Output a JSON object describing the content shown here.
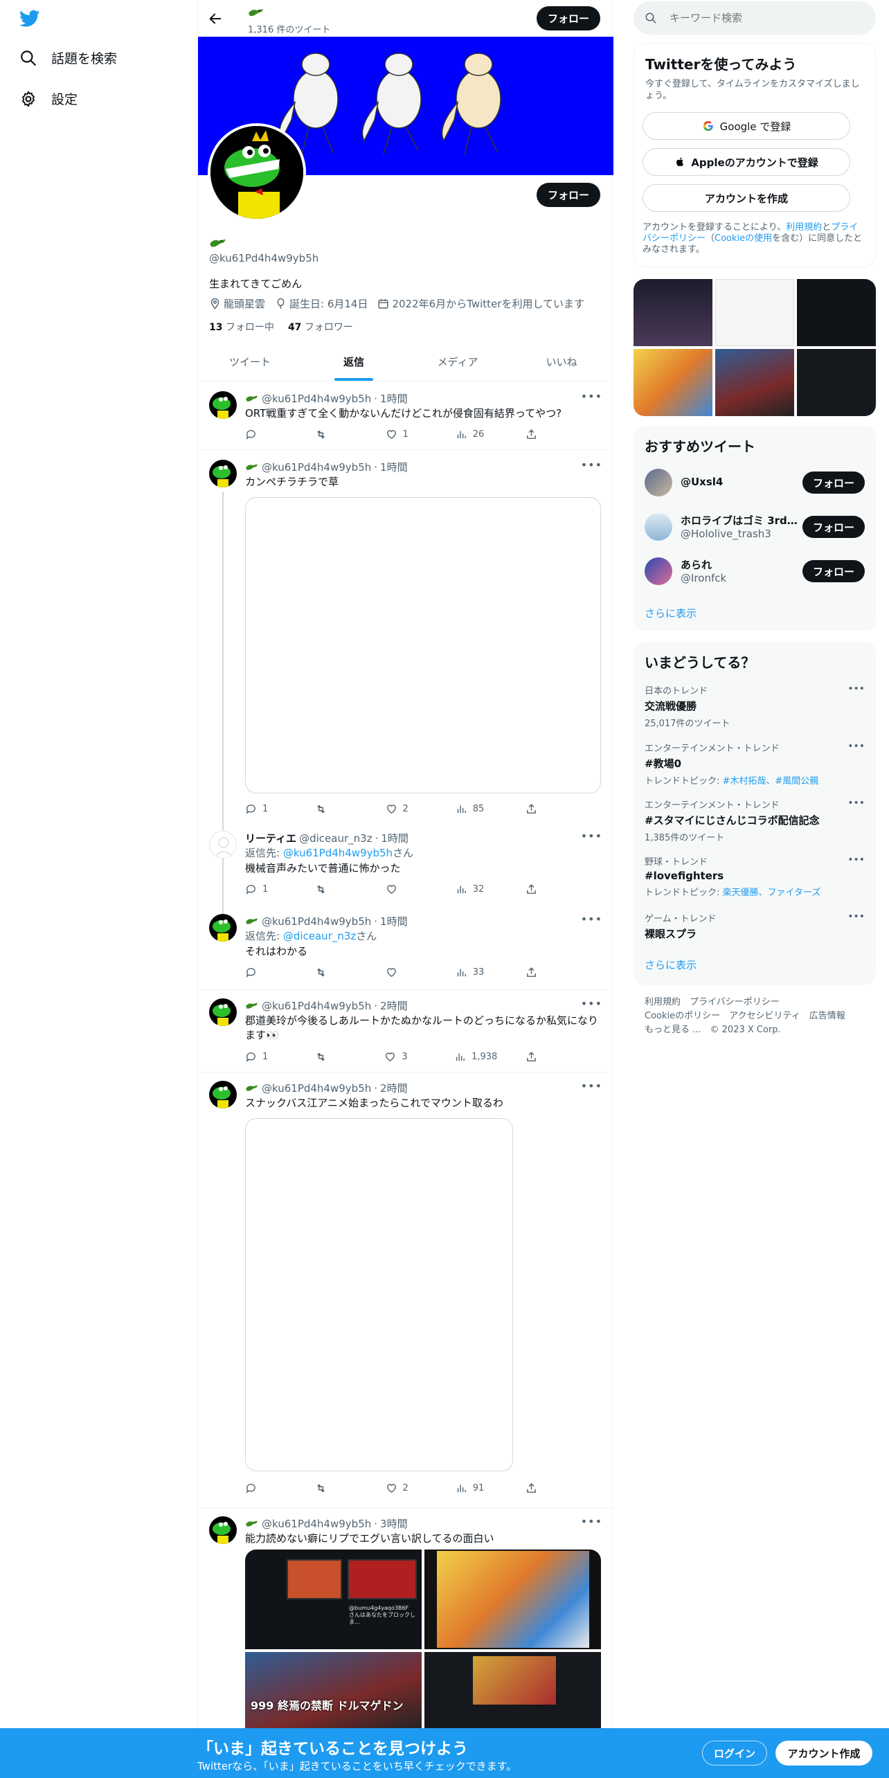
{
  "nav": {
    "explore_label": "話題を検索",
    "settings_label": "設定"
  },
  "profile_header": {
    "tweet_count": "1,316 件のツイート",
    "follow_label": "フォロー"
  },
  "profile": {
    "handle": "@ku61Pd4h4w9yb5h",
    "bio": "生まれてきてごめん",
    "location": "龍頭星雲",
    "birthday": "誕生日: 6月14日",
    "joined": "2022年6月からTwitterを利用しています",
    "following_count": "13",
    "following_label": "フォロー中",
    "followers_count": "47",
    "followers_label": "フォロワー",
    "follow_label": "フォロー"
  },
  "tabs": [
    "ツイート",
    "返信",
    "メディア",
    "いいね"
  ],
  "tweets": [
    {
      "handle": "@ku61Pd4h4w9yb5h",
      "time": "1時間",
      "text": "ORT戦重すぎて全く動かないんだけどこれが侵食固有結界ってやつ?",
      "replies": "",
      "likes": "1",
      "views": "26"
    },
    {
      "handle": "@ku61Pd4h4w9yb5h",
      "time": "1時間",
      "text": "カンペチラチラで草",
      "replies": "1",
      "likes": "2",
      "views": "85"
    },
    {
      "name": "リーティエ",
      "handle": "@diceaur_n3z",
      "time": "1時間",
      "reply_prefix": "返信先: ",
      "reply_to": "@ku61Pd4h4w9yb5h",
      "reply_suffix": "さん",
      "text": "機械音声みたいで普通に怖かった",
      "replies": "1",
      "likes": "",
      "views": "32"
    },
    {
      "handle": "@ku61Pd4h4w9yb5h",
      "time": "1時間",
      "reply_prefix": "返信先: ",
      "reply_to": "@diceaur_n3z",
      "reply_suffix": "さん",
      "text": "それはわかる",
      "replies": "",
      "likes": "",
      "views": "33"
    },
    {
      "handle": "@ku61Pd4h4w9yb5h",
      "time": "2時間",
      "text": "郡道美玲が今後るしあルートかたぬかなルートのどっちになるか私気になります👀",
      "replies": "1",
      "likes": "3",
      "views": "1,938"
    },
    {
      "handle": "@ku61Pd4h4w9yb5h",
      "time": "2時間",
      "text": "スナックバス江アニメ始まったらこれでマウント取るわ",
      "replies": "",
      "likes": "2",
      "views": "91"
    },
    {
      "handle": "@ku61Pd4h4w9yb5h",
      "time": "3時間",
      "text": "能力読めない癖にリプでエグい言い訳してるの面白い",
      "media_caption_tl": "@bumu4g4yaqo3B6F\nさんはあなたをブロックしま...",
      "media_caption_bl": "999 終焉の禁断 ドルマゲドン"
    }
  ],
  "search": {
    "placeholder": "キーワード検索"
  },
  "signup": {
    "title": "Twitterを使ってみよう",
    "subtitle": "今すぐ登録して、タイムラインをカスタマイズしましょう。",
    "google": "Google で登録",
    "apple": "Appleのアカウントで登録",
    "create": "アカウントを作成",
    "legal_1": "アカウントを登録することにより、",
    "legal_terms": "利用規約",
    "legal_2": "と",
    "legal_privacy": "プライバシーポリシー",
    "legal_3": "（",
    "legal_cookie": "Cookieの使用",
    "legal_4": "を含む）に同意したとみなされます。"
  },
  "recommended": {
    "title": "おすすめツイート",
    "users": [
      {
        "name": "@Uxsl4",
        "handle": ""
      },
      {
        "name": "ホロライブはゴミ 3rd...",
        "handle": "@Hololive_trash3"
      },
      {
        "name": "あられ",
        "handle": "@Ironfck"
      }
    ],
    "follow_label": "フォロー",
    "more": "さらに表示"
  },
  "trends": {
    "title": "いまどうしてる？",
    "items": [
      {
        "category": "日本のトレンド",
        "name": "交流戦優勝",
        "meta": "25,017件のツイート"
      },
      {
        "category": "エンターテインメント・トレンド",
        "name": "#教場0",
        "meta_prefix": "トレンドトピック: ",
        "meta_links": "#木村拓哉、#風間公親"
      },
      {
        "category": "エンターテインメント・トレンド",
        "name": "#スタマイにじさんじコラボ配信記念",
        "meta": "1,385件のツイート"
      },
      {
        "category": "野球・トレンド",
        "name": "#lovefighters",
        "meta_prefix": "トレンドトピック: ",
        "meta_links": "楽天優勝、ファイターズ"
      },
      {
        "category": "ゲーム・トレンド",
        "name": "裸眼スプラ",
        "meta": ""
      }
    ],
    "more": "さらに表示"
  },
  "footer": {
    "row1": "利用規約　プライバシーポリシー",
    "row2": "Cookieのポリシー　アクセシビリティ　広告情報",
    "row3": "もっと見る ...　© 2023 X Corp."
  },
  "bottom_bar": {
    "title": "「いま」起きていることを見つけよう",
    "subtitle": "Twitterなら、「いま」起きていることをいち早くチェックできます。",
    "login": "ログイン",
    "signup": "アカウント作成"
  },
  "colors": {
    "accent": "#1d9bf0",
    "banner": "#0000ff",
    "text": "#0f1419",
    "muted": "#536471"
  }
}
